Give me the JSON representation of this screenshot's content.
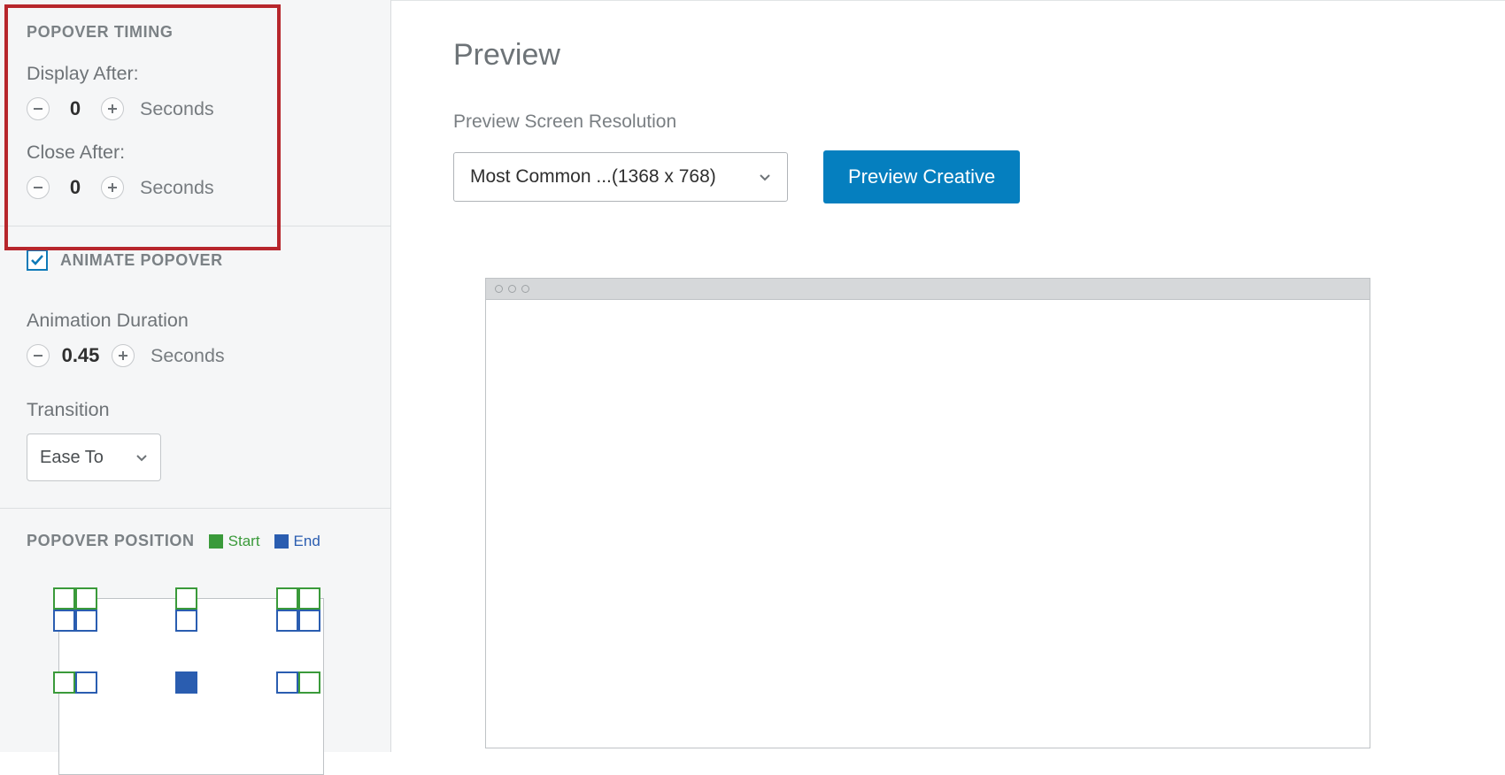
{
  "sidebar": {
    "timing": {
      "title": "POPOVER TIMING",
      "displayAfter": {
        "label": "Display After:",
        "value": "0",
        "unit": "Seconds"
      },
      "closeAfter": {
        "label": "Close After:",
        "value": "0",
        "unit": "Seconds"
      }
    },
    "animate": {
      "title": "ANIMATE POPOVER",
      "checked": true,
      "duration": {
        "label": "Animation Duration",
        "value": "0.45",
        "unit": "Seconds"
      },
      "transition": {
        "label": "Transition",
        "selected": "Ease To"
      }
    },
    "position": {
      "title": "POPOVER POSITION",
      "legendStart": "Start",
      "legendEnd": "End"
    }
  },
  "main": {
    "title": "Preview",
    "resolutionLabel": "Preview Screen Resolution",
    "resolutionSelected": "Most Common ...(1368 x 768)",
    "previewButton": "Preview Creative"
  },
  "colors": {
    "highlight": "#b7262c",
    "primary": "#057fbf",
    "green": "#3a9a3a",
    "blue": "#2a5db0"
  }
}
